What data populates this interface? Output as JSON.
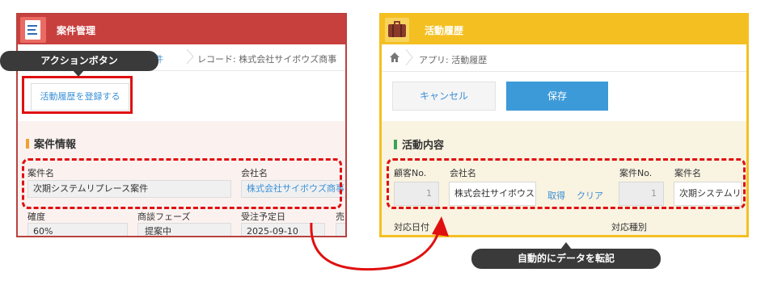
{
  "left": {
    "title": "案件管理",
    "breadcrumb": [
      "案件",
      "レコード: 株式会社サイボウズ商事"
    ],
    "action_button": "活動履歴を登録する",
    "section_title": "案件情報",
    "fields": {
      "project_name_label": "案件名",
      "project_name_value": "次期システムリプレース案件",
      "company_label": "会社名",
      "company_value": "株式会社サイボウズ商事",
      "certainty_label": "確度",
      "certainty_value": "60%",
      "phase_label": "商談フェーズ",
      "phase_value": "提案中",
      "order_date_label": "受注予定日",
      "order_date_value": "2025-09-10",
      "extra_label": "売"
    }
  },
  "right": {
    "title": "活動履歴",
    "breadcrumb": "アプリ: 活動履歴",
    "cancel_label": "キャンセル",
    "save_label": "保存",
    "section_title": "活動内容",
    "fields": {
      "customer_no_label": "顧客No.",
      "customer_no_value": "1",
      "company_label": "会社名",
      "company_value": "株式会社サイボウス",
      "fetch_label": "取得",
      "clear_label": "クリア",
      "project_no_label": "案件No.",
      "project_no_value": "1",
      "project_name_label": "案件名",
      "project_name_value": "次期システムリ",
      "date_label": "対応日付",
      "type_label": "対応種別"
    }
  },
  "annotations": {
    "action_button_callout": "アクションボタン",
    "transfer_callout": "自動的にデータを転記"
  },
  "colors": {
    "left_header": "#c8403e",
    "right_header": "#f4c021",
    "annotation_red": "#e01010",
    "link_blue": "#3a8fd6",
    "save_button": "#3c9ad8"
  }
}
